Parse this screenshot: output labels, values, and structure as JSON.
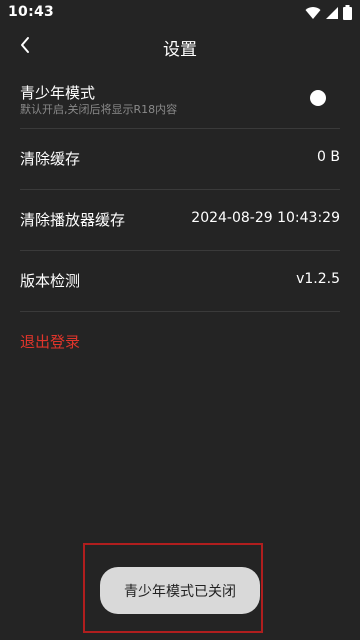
{
  "status_bar": {
    "time": "10:43",
    "icons": [
      "wifi-icon",
      "signal-icon",
      "battery-icon"
    ]
  },
  "header": {
    "title": "设置",
    "back_icon": "chevron-left-icon"
  },
  "settings": {
    "youth_mode": {
      "label": "青少年模式",
      "description": "默认开启,关闭后将显示R18内容",
      "enabled": false
    },
    "clear_cache": {
      "label": "清除缓存",
      "value": "0 B"
    },
    "clear_player_cache": {
      "label": "清除播放器缓存",
      "value": "2024-08-29 10:43:29"
    },
    "version_check": {
      "label": "版本检测",
      "value": "v1.2.5"
    },
    "logout_label": "退出登录"
  },
  "toast": {
    "message": "青少年模式已关闭"
  },
  "colors": {
    "background": "#242424",
    "logout": "#e0352b",
    "toast_bg": "#d9d9d9",
    "highlight_border": "#b01e1e"
  }
}
